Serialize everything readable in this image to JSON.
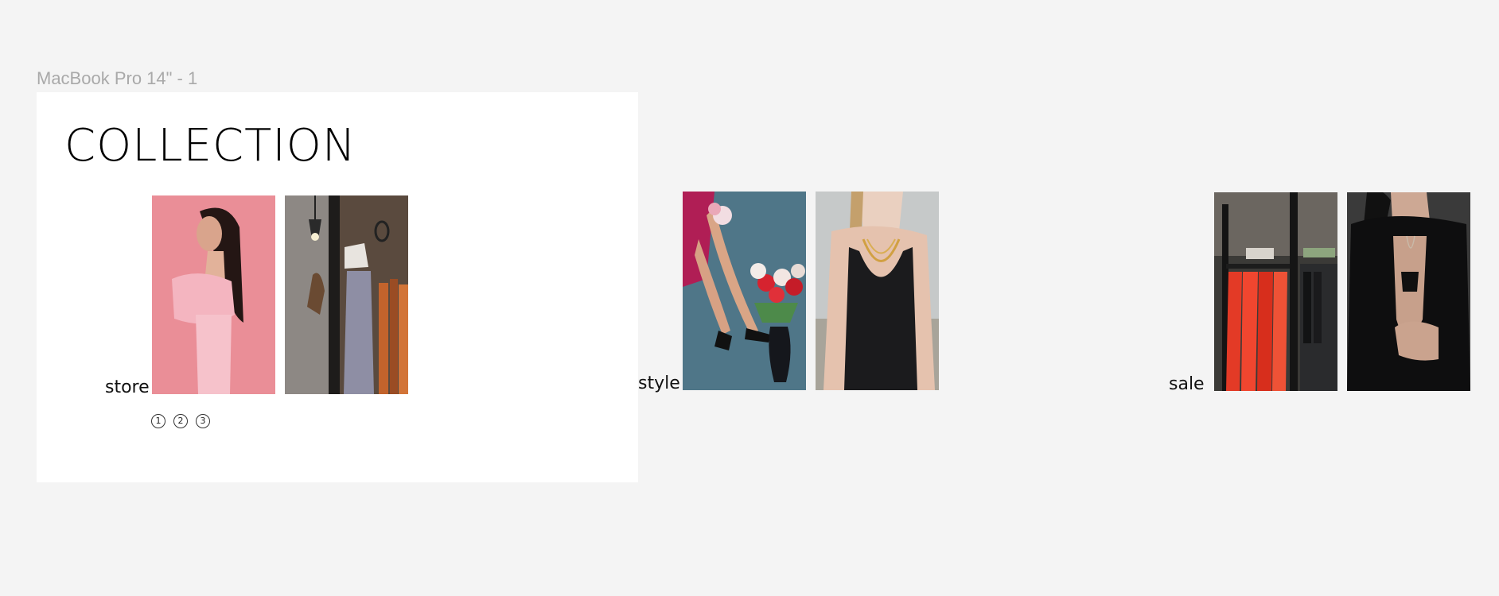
{
  "frame": {
    "label": "MacBook Pro 14\" - 1"
  },
  "page": {
    "title": "COLLECTION"
  },
  "sections": {
    "store": {
      "label": "store"
    },
    "style": {
      "label": "style"
    },
    "sale": {
      "label": "sale"
    }
  },
  "pagination": {
    "pages": [
      "1",
      "2",
      "3"
    ]
  },
  "colors": {
    "canvas": "#f4f4f4",
    "frame_bg": "#ffffff",
    "label_gray": "#a9a9a9",
    "text": "#000000"
  }
}
